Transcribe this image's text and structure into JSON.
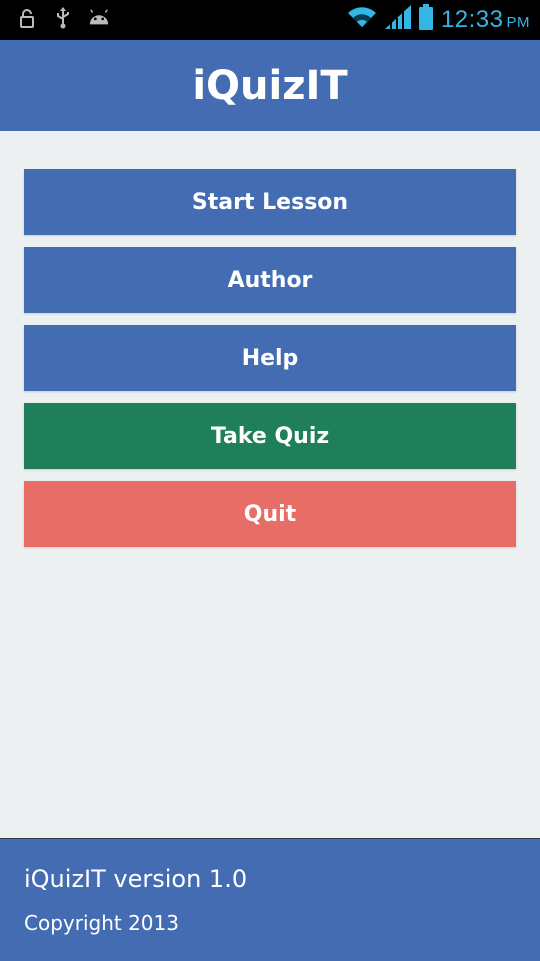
{
  "status_bar": {
    "time": "12:33",
    "ampm": "PM",
    "icons_left": [
      "lock-icon",
      "usb-icon",
      "android-icon"
    ],
    "icons_right": [
      "wifi-icon",
      "signal-icon",
      "battery-icon"
    ],
    "accent_color": "#33b5e5"
  },
  "app": {
    "title": "iQuizIT"
  },
  "menu": {
    "start_lesson": "Start Lesson",
    "author": "Author",
    "help": "Help",
    "take_quiz": "Take Quiz",
    "quit": "Quit"
  },
  "footer": {
    "version": "iQuizIT version 1.0",
    "copyright": "Copyright 2013"
  },
  "colors": {
    "primary": "#446cb3",
    "success": "#1f7f5a",
    "danger": "#e76d67",
    "background": "#ecf0f1"
  }
}
